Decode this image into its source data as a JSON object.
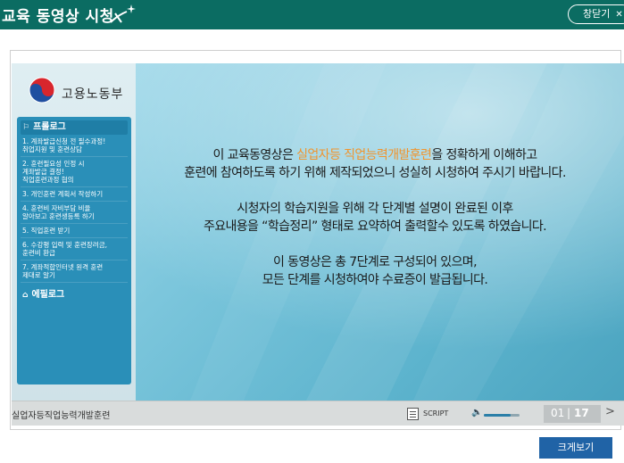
{
  "header": {
    "title": "교육 동영상 시청",
    "close_label": "창닫기",
    "close_icon": "✕"
  },
  "sidebar": {
    "logo_text": "고용노동부",
    "menu_heading": "프롤로그",
    "items": [
      {
        "label": "1. 계좌발급신청 전 필수과정!\n취업지원 및 훈련상담"
      },
      {
        "label": "2. 훈련필요성 인정 시\n계좌발급 결정!\n직업훈련과정 협의"
      },
      {
        "label": "3. 개인훈련 계획서 작성하기"
      },
      {
        "label": "4. 훈련비 자비부담 비율\n알아보고 훈련생등록 하기"
      },
      {
        "label": "5. 직업훈련 받기"
      },
      {
        "label": "6. 수강평 입력 및 훈련장려금,\n훈련비 환급"
      },
      {
        "label": "7. 계좌적합인터넷 원격 훈련\n제대로 알기"
      }
    ],
    "menu_footer": "에필로그"
  },
  "content": {
    "para1_line1_pre": "이 교육동영상은 ",
    "para1_line1_highlight": "실업자등 직업능력개발훈련",
    "para1_line1_post": "을 정확하게 이해하고",
    "para1_line2": "훈련에 참여하도록 하기 위해 제작되었으니 성실히 시청하여 주시기 바랍니다.",
    "para2_line1": "시청자의 학습지원을 위해 각 단계별 설명이 완료된 이후",
    "para2_line2": "주요내용을 “학습정리” 형태로 요약하여 출력할수 있도록 하였습니다.",
    "para3_line1": "이 동영상은 총 7단계로 구성되어 있으며,",
    "para3_line2": "모든 단계를 시청하여야 수료증이 발급됩니다."
  },
  "controls": {
    "course_name": "실업자등직업능력개발훈련",
    "script_label": "SCRIPT",
    "volume_level": 0.75,
    "current_page": "01",
    "separator": "|",
    "total_pages": "17",
    "next_symbol": ">"
  },
  "footer": {
    "enlarge_label": "크게보기"
  },
  "colors": {
    "header_bg": "#0b6c62",
    "highlight": "#f0942e",
    "menu_bg": "#2a8fb8",
    "enlarge_bg": "#2063a6"
  }
}
